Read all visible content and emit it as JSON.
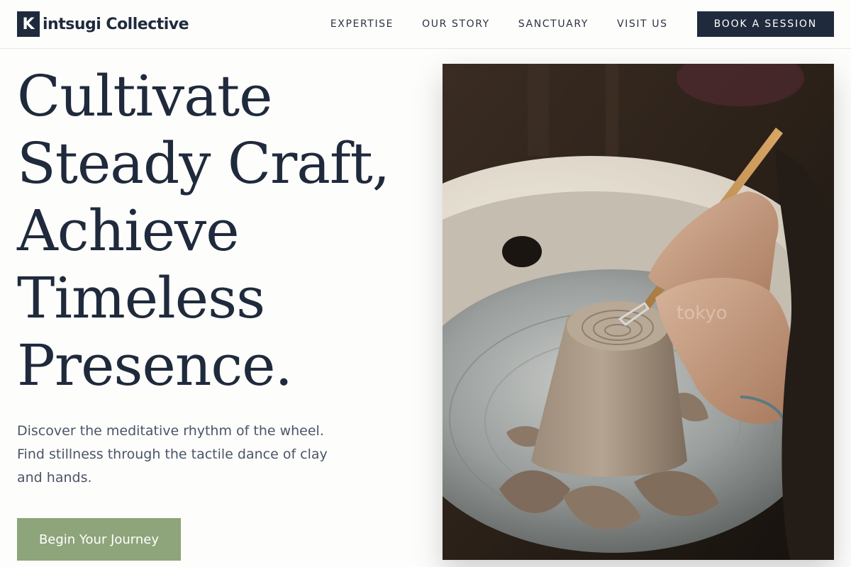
{
  "brand": {
    "mark": "K",
    "name": "intsugi Collective"
  },
  "nav": {
    "links": [
      "EXPERTISE",
      "OUR STORY",
      "SANCTUARY",
      "VISIT US"
    ],
    "cta": "BOOK A SESSION"
  },
  "hero": {
    "headline_lines": [
      "Cultivate",
      "Steady Craft,",
      "Achieve",
      "Timeless",
      "Presence."
    ],
    "subtitle": "Discover the meditative rhythm of the wheel. Find stillness through the tactile dance of clay and hands.",
    "cta": "Begin Your Journey",
    "image_watermark": "tokyo"
  },
  "colors": {
    "navy": "#1f2a3c",
    "sage": "#8ea47a",
    "background": "#fdfdfb",
    "text_muted": "#4a5567"
  },
  "icons": {
    "logo": "k-logo-icon"
  }
}
